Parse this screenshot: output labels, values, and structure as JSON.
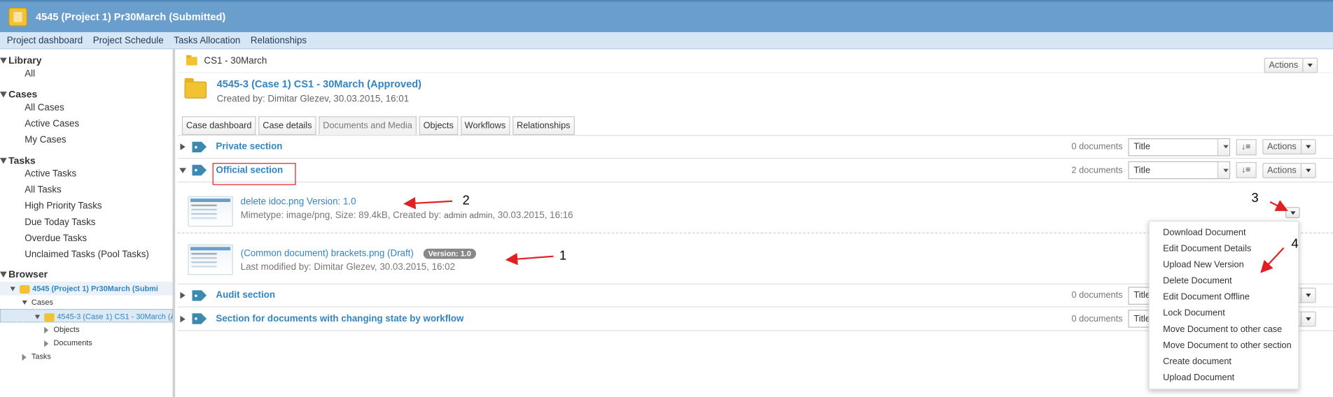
{
  "window": {
    "title": "4545 (Project 1) Pr30March (Submitted)"
  },
  "menubar": [
    "Project dashboard",
    "Project Schedule",
    "Tasks Allocation",
    "Relationships"
  ],
  "sidebar": {
    "library": {
      "title": "Library",
      "items": [
        "All"
      ]
    },
    "cases": {
      "title": "Cases",
      "items": [
        "All Cases",
        "Active Cases",
        "My Cases"
      ]
    },
    "tasks": {
      "title": "Tasks",
      "items": [
        "Active Tasks",
        "All Tasks",
        "High Priority Tasks",
        "Due Today Tasks",
        "Overdue Tasks",
        "Unclaimed Tasks (Pool Tasks)"
      ]
    },
    "browser": {
      "title": "Browser",
      "project": "4545 (Project 1) Pr30March (Submi",
      "cases_label": "Cases",
      "case": "4545-3 (Case 1) CS1 - 30March (Ap",
      "objects": "Objects",
      "documents": "Documents",
      "tasks": "Tasks"
    }
  },
  "main": {
    "breadcrumb": "CS1 - 30March",
    "actions_label": "Actions",
    "case_title": "4545-3 (Case 1) CS1 - 30March (Approved)",
    "case_meta": "Created by: Dimitar Glezev, 30.03.2015, 16:01",
    "tabs": [
      "Case dashboard",
      "Case details",
      "Documents and Media",
      "Objects",
      "Workflows",
      "Relationships"
    ],
    "active_tab": "Documents and Media",
    "sections": [
      {
        "title": "Private section",
        "count": "0 documents",
        "sort": "Title"
      },
      {
        "title": "Official section",
        "count": "2 documents",
        "sort": "Title"
      },
      {
        "title": "Audit section",
        "count": "0 documents",
        "sort": "Title"
      },
      {
        "title": "Section for documents with changing state by workflow",
        "count": "0 documents",
        "sort": "Title"
      }
    ],
    "documents": [
      {
        "name": "delete idoc.png",
        "version": "Version: 1.0",
        "meta": "Mimetype: image/png, Size: 89.4kB, Created by: ",
        "meta_user": "admin admin",
        "meta_time": ", 30.03.2015, 16:16"
      },
      {
        "name": "(Common document) brackets.png (Draft)",
        "version_badge": "Version: 1.0",
        "meta": "Last modified by: Dimitar Glezev, 30.03.2015, 16:02"
      }
    ],
    "context_menu": [
      "Download Document",
      "Edit Document Details",
      "Upload New Version",
      "Delete Document",
      "Edit Document Offline",
      "Lock Document",
      "Move Document to other case",
      "Move Document to other section",
      "Create document",
      "Upload Document"
    ]
  },
  "annotations": [
    "1",
    "2",
    "3",
    "4"
  ],
  "colors": {
    "titlebar": "#6a9fcd",
    "link": "#3385c2",
    "annotation": "#e02020"
  }
}
